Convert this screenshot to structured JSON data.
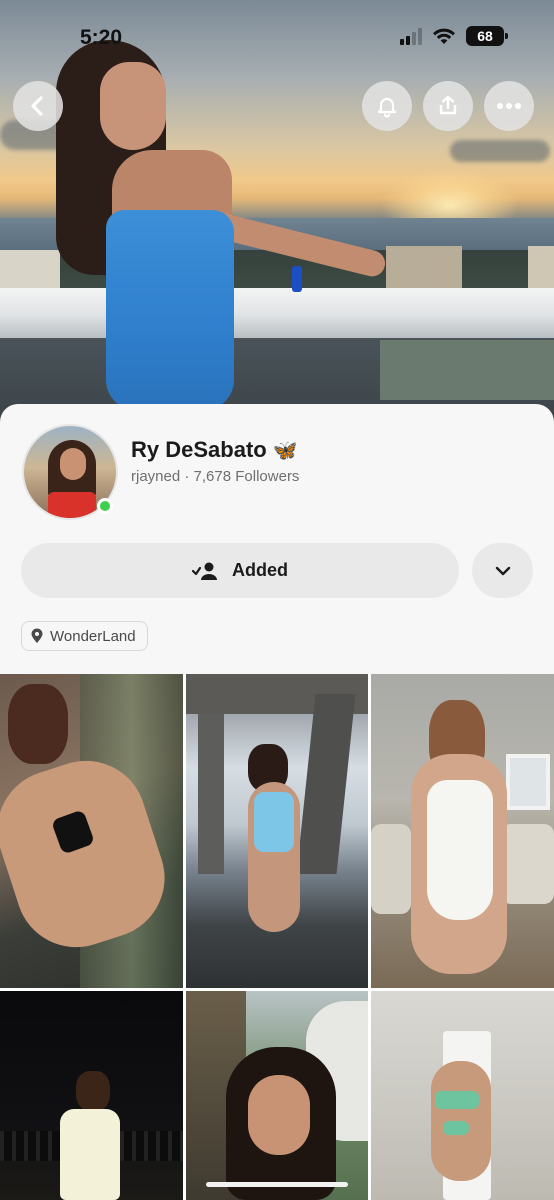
{
  "status_bar": {
    "time": "5:20",
    "battery": "68"
  },
  "hero": {
    "back_icon": "chevron-left-icon",
    "actions": [
      "bell-icon",
      "share-icon",
      "more-horizontal-icon"
    ]
  },
  "profile": {
    "display_name": "Ry DeSabato",
    "name_emoji": "🦋",
    "username": "rjayned",
    "separator": " · ",
    "followers": "7,678 Followers",
    "online": true
  },
  "actions": {
    "added_label": "Added",
    "added_icon": "person-check-icon",
    "dropdown_icon": "chevron-down-icon"
  },
  "location": {
    "icon": "location-pin-icon",
    "label": "WonderLand"
  },
  "colors": {
    "online": "#3bd14d",
    "button_bg": "#e9e9e9",
    "card_bg": "#f7f7f7"
  },
  "grid": {
    "tiles": [
      {
        "label": "photo-1"
      },
      {
        "label": "photo-2"
      },
      {
        "label": "photo-3"
      },
      {
        "label": "photo-4"
      },
      {
        "label": "photo-5"
      },
      {
        "label": "photo-6"
      }
    ]
  }
}
